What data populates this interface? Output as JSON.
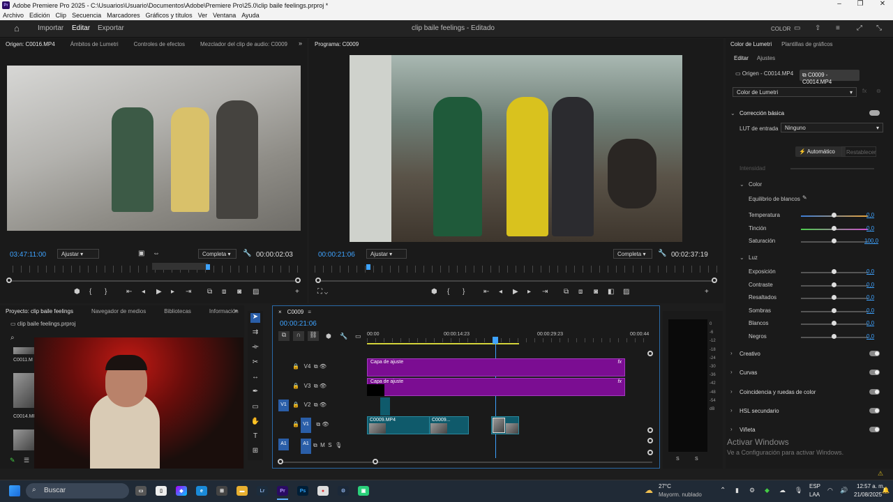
{
  "window": {
    "title": "Adobe Premiere Pro 2025 - C:\\Usuarios\\Usuario\\Documentos\\Adobe\\Premiere Pro\\25.0\\clip baile feelings.prproj *"
  },
  "menu": [
    "Archivo",
    "Edición",
    "Clip",
    "Secuencia",
    "Marcadores",
    "Gráficos y títulos",
    "Ver",
    "Ventana",
    "Ayuda"
  ],
  "workspace": {
    "importar": "Importar",
    "editar": "Editar",
    "exportar": "Exportar",
    "project_title": "clip baile feelings - Editado",
    "color": "COLOR"
  },
  "source": {
    "tabs": [
      "Origen: C0016.MP4",
      "Ámbitos de Lumetri",
      "Controles de efectos",
      "Mezclador del clip de audio: C0009"
    ],
    "timecode": "03:47:11:00",
    "fit": "Ajustar",
    "quality": "Completa",
    "duration": "00:00:02:03"
  },
  "program": {
    "tab": "Programa: C0009",
    "timecode": "00:00:21:06",
    "fit": "Ajustar",
    "quality": "Completa",
    "duration": "00:02:37:19"
  },
  "lumetri": {
    "tabs": [
      "Color de Lumetri",
      "Plantillas de gráficos"
    ],
    "subtabs": [
      "Editar",
      "Ajustes"
    ],
    "origin_clip": "Origen - C0014.MP4",
    "seq_clip": "C0009 - C0014.MP4",
    "effect": "Color de Lumetri",
    "basic": "Corrección básica",
    "lut_label": "LUT de entrada",
    "lut_value": "Ninguno",
    "auto": "Automático",
    "reset": "Restablecer",
    "intensity": "Intensidad",
    "color_section": "Color",
    "wb": "Equilibrio de blancos",
    "color_rows": [
      {
        "label": "Temperatura",
        "value": "0,0"
      },
      {
        "label": "Tinción",
        "value": "0,0"
      },
      {
        "label": "Saturación",
        "value": "100,0"
      }
    ],
    "luz_section": "Luz",
    "luz_rows": [
      {
        "label": "Exposición",
        "value": "0,0"
      },
      {
        "label": "Contraste",
        "value": "0,0"
      },
      {
        "label": "Resaltados",
        "value": "0,0"
      },
      {
        "label": "Sombras",
        "value": "0,0"
      },
      {
        "label": "Blancos",
        "value": "0,0"
      },
      {
        "label": "Negros",
        "value": "0,0"
      }
    ],
    "sections": [
      "Creativo",
      "Curvas",
      "Coincidencia y ruedas de color",
      "HSL secundario",
      "Viñeta"
    ],
    "activate_title": "Activar Windows",
    "activate_sub": "Ve a Configuración para activar Windows."
  },
  "project": {
    "tabs": [
      "Proyecto: clip baile feelings",
      "Navegador de medios",
      "Bibliotecas",
      "Información"
    ],
    "file": "clip baile feelings.prproj",
    "items": [
      "C0011.M",
      "C0014.MP4"
    ]
  },
  "timeline": {
    "tab": "C0009",
    "timecode": "00:00:21:06",
    "ruler": [
      "00:00",
      "00:00:14:23",
      "00:00:29:23",
      "00:00:44"
    ],
    "tracks": [
      "V4",
      "V3",
      "V2",
      "V1",
      "A1"
    ],
    "adjust_label": "Capa de ajuste",
    "clip1": "C0009.MP4",
    "clip2": "C0009...",
    "audio_marks": [
      "M",
      "S"
    ]
  },
  "meter": {
    "scale": [
      "0",
      "-6",
      "-12",
      "-18",
      "-24",
      "-30",
      "-36",
      "-42",
      "-48",
      "-54",
      "dB"
    ],
    "bottom": [
      "S",
      "S"
    ]
  },
  "taskbar": {
    "search": "Buscar",
    "weather_temp": "27°C",
    "weather_desc": "Mayorm. nublado",
    "lang": "ESP",
    "lang2": "LAA",
    "time": "12:57 a. m.",
    "date": "21/08/2025"
  }
}
